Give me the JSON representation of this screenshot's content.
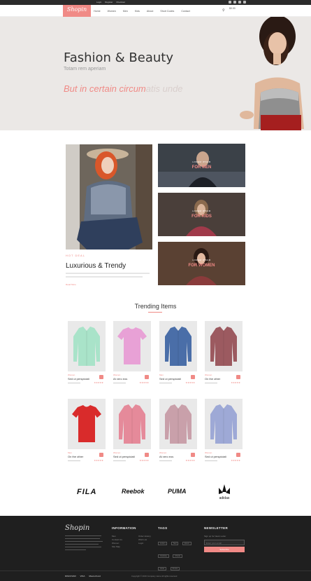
{
  "topbar": {
    "links": [
      "Login",
      "Register",
      "Checkout"
    ]
  },
  "nav": {
    "logo": "Shopin",
    "items": [
      "Home",
      "Women",
      "Men",
      "Kids",
      "About",
      "Short Codes",
      "Contact"
    ],
    "cart": "$0.00"
  },
  "hero": {
    "title": "Fashion & Beauty",
    "subtitle": "Totam rem aperiam",
    "tagline_strong": "But in certain circum",
    "tagline_fade": "atis unde"
  },
  "feature": {
    "label": "HOT DEAL",
    "title": "Luxurious & Trendy",
    "more": "Read More"
  },
  "categories": [
    {
      "small": "LOREM IPSUM",
      "big": "FOR MEN",
      "bg": "#3b4148"
    },
    {
      "small": "LOREM IPSUM",
      "big": "FOR KIDS",
      "bg": "#4a3f3a"
    },
    {
      "small": "LOREM IPSUM",
      "big": "FOR WOMEN",
      "bg": "#5a4133"
    }
  ],
  "trending": {
    "title": "Trending Items",
    "products": [
      {
        "brand": "Women",
        "name": "Sed ut perspiciati",
        "shirt": "#a9e3c9",
        "type": "shirt"
      },
      {
        "brand": "Women",
        "name": "At vero eos",
        "shirt": "#e8a1d6",
        "type": "tee"
      },
      {
        "brand": "Men",
        "name": "Sed ut perspiciati",
        "shirt": "#4a6ea8",
        "type": "shirt"
      },
      {
        "brand": "Women",
        "name": "On the other",
        "shirt": "#9c5a60",
        "type": "shirt"
      },
      {
        "brand": "Men",
        "name": "On the other",
        "shirt": "#d92b2b",
        "type": "tee"
      },
      {
        "brand": "Women",
        "name": "Sed ut perspiciati",
        "shirt": "#e58a9a",
        "type": "shirt"
      },
      {
        "brand": "Women",
        "name": "At vero eos",
        "shirt": "#c9a0aa",
        "type": "shirt"
      },
      {
        "brand": "Women",
        "name": "Sed ut perspiciati",
        "shirt": "#9ea9d6",
        "type": "shirt"
      }
    ]
  },
  "brands": [
    "FILA",
    "Reebok",
    "PUMA",
    "adidas"
  ],
  "footer": {
    "logo": "Shopin",
    "info_heading": "INFORMATION",
    "info_items": [
      "Men",
      "Contact Us",
      "Women",
      "Site Map"
    ],
    "info_items2": [
      "Order History",
      "Wish List",
      "Login"
    ],
    "tags_heading": "TAGS",
    "tags": [
      "Lorem",
      "Sed",
      "Ipsum",
      "Contrary",
      "Chunk",
      "Amet",
      "Omnis"
    ],
    "newsletter_heading": "NEWSLETTER",
    "newsletter_text": "Sign up for News Letter",
    "newsletter_placeholder": "Enter your email",
    "newsletter_button": "Subscribe",
    "payments": [
      "DISCOVER",
      "VISA",
      "MasterCard"
    ],
    "copyright": "Copyright © 2016 Company name All rights reserved"
  }
}
